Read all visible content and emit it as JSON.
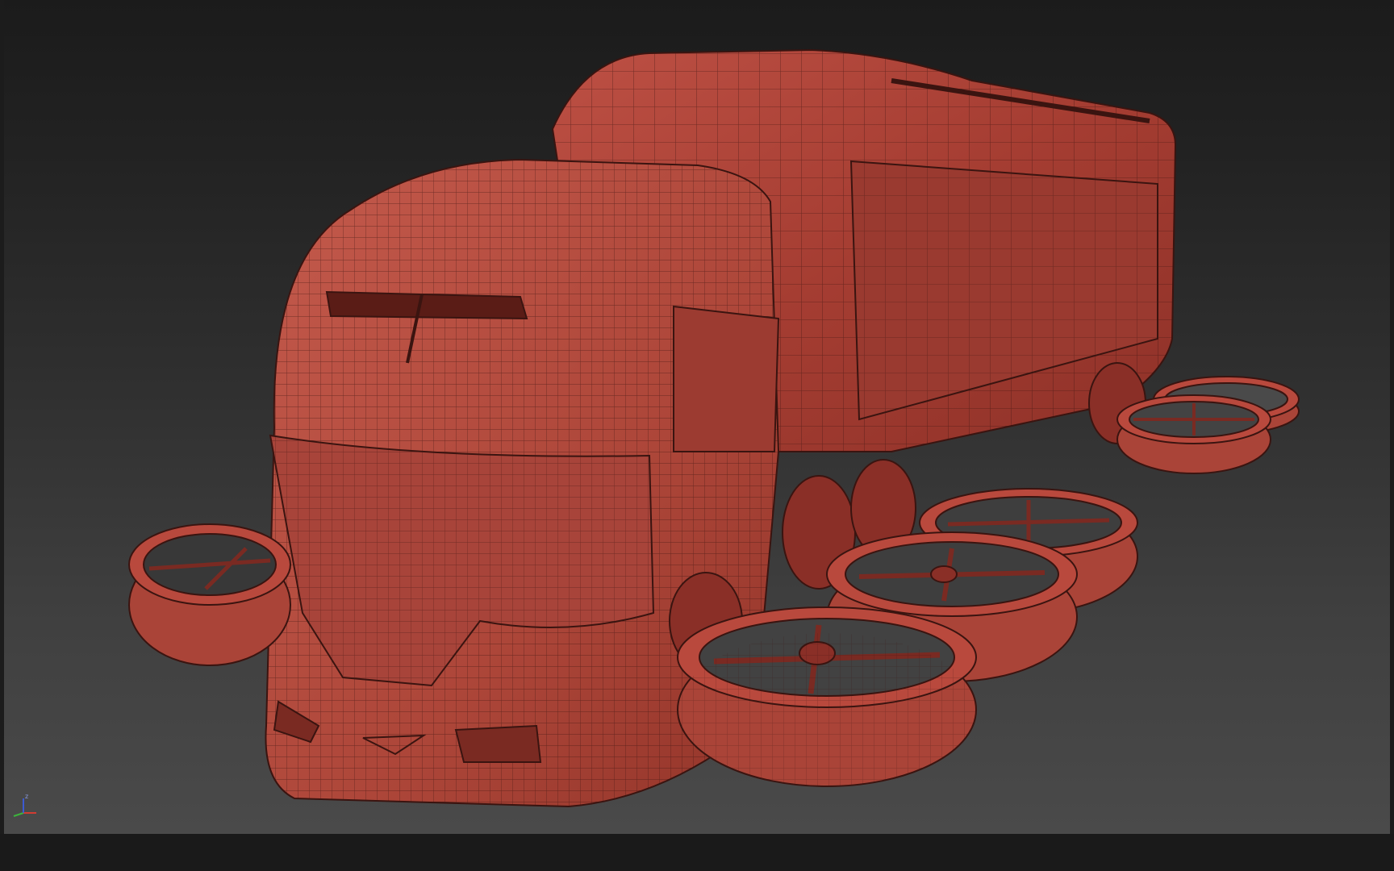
{
  "viewport": {
    "background_top": "#1b1b1b",
    "background_bottom": "#4a4a4a",
    "model_color": "#b5483c",
    "wire_color": "#3a1410",
    "object": "flying-truck-wireframe-model"
  },
  "axis_gizmo": {
    "x_color": "#d23c32",
    "y_color": "#3cb43c",
    "z_color": "#3c5ad2",
    "z_label": "z"
  }
}
